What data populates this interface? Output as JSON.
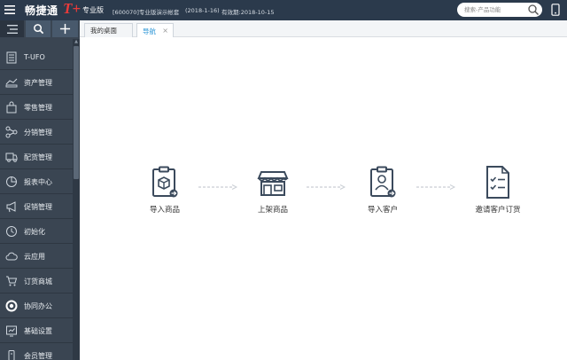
{
  "header": {
    "brand": "畅捷通",
    "brand_mark": "T+",
    "edition": "专业版",
    "account": "[600070]专业版演示帐套",
    "date": "(2018-1-16)",
    "valid": "有效期:2018-10-15",
    "search_placeholder": "搜索-产品功能",
    "icons": [
      "menu-icon",
      "search-icon",
      "phone-icon"
    ]
  },
  "sidebar": {
    "tools": [
      "collapse-icon",
      "search-icon",
      "plus-icon"
    ],
    "items": [
      {
        "label": "T-UFO",
        "icon": "report-sheet-icon"
      },
      {
        "label": "资产管理",
        "icon": "asset-icon"
      },
      {
        "label": "零售管理",
        "icon": "retail-icon"
      },
      {
        "label": "分销管理",
        "icon": "distribution-icon"
      },
      {
        "label": "配货管理",
        "icon": "delivery-truck-icon"
      },
      {
        "label": "报表中心",
        "icon": "pie-chart-icon"
      },
      {
        "label": "促销管理",
        "icon": "megaphone-icon"
      },
      {
        "label": "初始化",
        "icon": "clock-icon"
      },
      {
        "label": "云应用",
        "icon": "cloud-icon"
      },
      {
        "label": "订货商城",
        "icon": "cart-icon"
      },
      {
        "label": "协同办公",
        "icon": "collaboration-icon"
      },
      {
        "label": "基础设置",
        "icon": "settings-icon"
      },
      {
        "label": "会员管理",
        "icon": "member-icon"
      }
    ]
  },
  "tabs": [
    {
      "label": "我的桌面",
      "active": false
    },
    {
      "label": "导航",
      "active": true,
      "close": "×"
    }
  ],
  "steps": [
    {
      "label": "导入商品",
      "icon": "clipboard-box-icon"
    },
    {
      "label": "上架商品",
      "icon": "storefront-icon"
    },
    {
      "label": "导入客户",
      "icon": "clipboard-person-icon"
    },
    {
      "label": "邀请客户订货",
      "icon": "checklist-icon"
    }
  ],
  "colors": {
    "topbar": "#2b3a4c",
    "sidebar": "#3a4552",
    "accent": "#2b95d6",
    "brand_red": "#e93a3a",
    "icon_dark": "#3b4a5c"
  }
}
